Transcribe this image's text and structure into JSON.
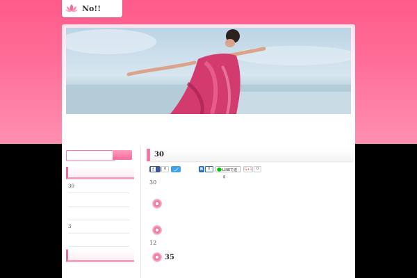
{
  "site": {
    "title": "No!!"
  },
  "colors": {
    "accent": "#f06b98",
    "band_top": "#ff5a8a",
    "band_bottom": "#ff8fb0"
  },
  "sidebar": {
    "items": [
      "30",
      "",
      "",
      "3",
      ""
    ]
  },
  "post": {
    "title": "30",
    "share": {
      "facebook_count": "0",
      "hatena_count": "0",
      "line_label": "LINEで送る",
      "gplus_label": "G+1",
      "gplus_count": "0"
    },
    "paragraphs": [
      "30",
      "12"
    ],
    "heading": "35"
  }
}
